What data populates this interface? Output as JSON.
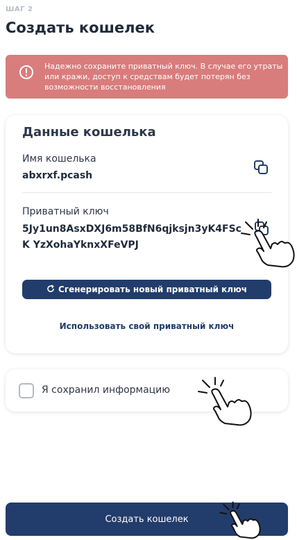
{
  "header": {
    "step": "ШАГ 2",
    "title": "Создать кошелек"
  },
  "alert": {
    "icon": "exclamation-circle-icon",
    "text": "Надежно сохраните приватный ключ. В случае его утраты или кражи, доступ к средствам будет потерян без возможности восстановления",
    "color": "#d97c7c"
  },
  "wallet_card": {
    "title": "Данные кошелька",
    "name_label": "Имя кошелька",
    "name_value": "abxrxf.pcash",
    "key_label": "Приватный ключ",
    "key_value": "5Jy1un8AsxDXJ6m58BfN6qjksjn3yK4FScK YzXohaYknxXFeVPJ",
    "generate_button": "Сгенерировать новый приватный ключ",
    "own_key_link": "Использовать свой приватный ключ"
  },
  "confirm": {
    "checkbox_label": "Я сохранил информацию",
    "checked": false
  },
  "footer": {
    "create_button": "Создать кошелек"
  },
  "colors": {
    "primary": "#223d6b",
    "alert": "#d97c7c",
    "text": "#1f2a3a"
  }
}
